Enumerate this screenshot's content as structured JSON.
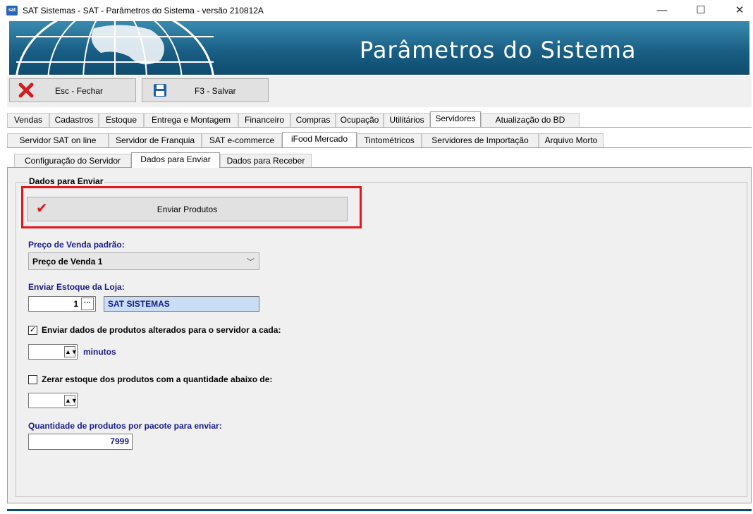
{
  "window": {
    "title": "SAT Sistemas - SAT - Parâmetros do Sistema - versão 210812A",
    "icon_text": "sat",
    "minimize": "—",
    "maximize": "☐",
    "close": "✕"
  },
  "banner": {
    "title": "Parâmetros do Sistema"
  },
  "toolbar": {
    "close_label": "Esc - Fechar",
    "save_label": "F3 - Salvar"
  },
  "main_tabs": [
    "Vendas",
    "Cadastros",
    "Estoque",
    "Entrega e Montagem",
    "Financeiro",
    "Compras",
    "Ocupação",
    "Utilitários",
    "Servidores",
    "Atualização do BD"
  ],
  "server_tabs": [
    "Servidor SAT on line",
    "Servidor de Franquia",
    "SAT e-commerce",
    "iFood Mercado",
    "Tintométricos",
    "Servidores de Importação",
    "Arquivo Morto"
  ],
  "ifood_tabs": [
    "Configuração do Servidor",
    "Dados para Enviar",
    "Dados para Receber"
  ],
  "dados_enviar": {
    "group_title": "Dados para Enviar",
    "send_button": "Enviar Produtos",
    "price_label": "Preço de Venda padrão:",
    "price_value": "Preço de Venda 1",
    "stock_label": "Enviar Estoque da Loja:",
    "store_code": "1",
    "store_name": "SAT SISTEMAS",
    "send_changed_label": "Enviar dados de produtos alterados para o servidor a cada:",
    "send_changed_checked": true,
    "minutes_value": "",
    "minutes_label": "minutos",
    "zero_stock_label": "Zerar estoque dos produtos com a quantidade abaixo de:",
    "zero_stock_checked": false,
    "zero_stock_value": "",
    "package_label": "Quantidade de produtos por pacote para enviar:",
    "package_value": "7999"
  },
  "colors": {
    "highlight": "#e5161c",
    "label_blue": "#1b1b8a",
    "banner": "#1a5f86"
  }
}
